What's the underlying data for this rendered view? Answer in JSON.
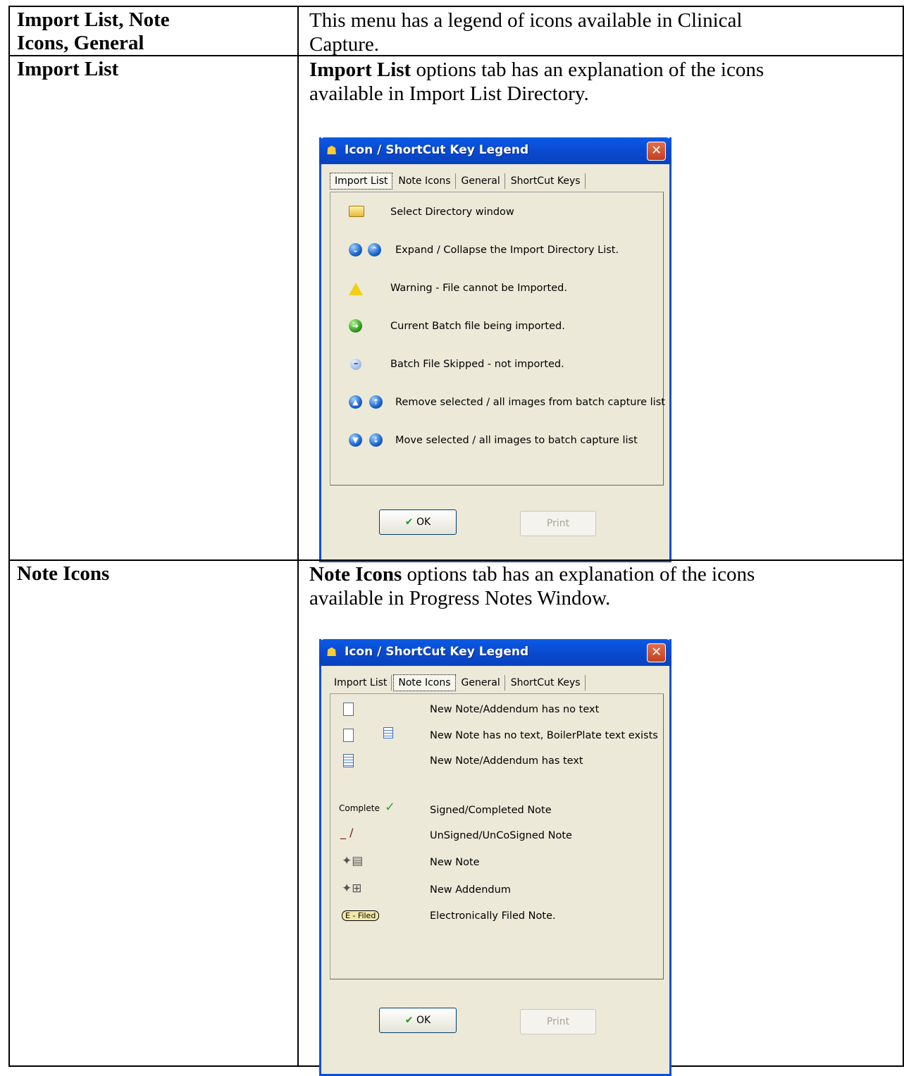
{
  "row1": {
    "heading": "Import List, Note Icons, General",
    "heading_line1": "Import List, Note",
    "heading_line2": "Icons, General",
    "text_line1": "This menu has a legend of icons available in Clinical",
    "text_line2": "Capture."
  },
  "row2": {
    "heading": "Import List",
    "text_bold": "Import List",
    "text_rest_line1": " options tab has an explanation of the icons",
    "text_line2": "available in Import List Directory.",
    "dialog": {
      "title": "Icon / ShortCut Key Legend",
      "tabs": [
        "Import List",
        "Note Icons",
        "General",
        "ShortCut Keys"
      ],
      "active_tab": "Import List",
      "items": [
        {
          "icon": "folder-icon",
          "label": "Select Directory window"
        },
        {
          "icon": "expand-collapse-icons",
          "label": "Expand / Collapse the Import Directory List."
        },
        {
          "icon": "warning-icon",
          "label": "Warning - File cannot be Imported."
        },
        {
          "icon": "green-arrow-icon",
          "label": "Current Batch file being imported."
        },
        {
          "icon": "minus-icon",
          "label": "Batch File Skipped  - not imported."
        },
        {
          "icon": "up-arrows-icon",
          "label": "Remove selected / all images from batch capture list"
        },
        {
          "icon": "down-arrows-icon",
          "label": "Move selected / all images to batch capture list"
        }
      ],
      "ok_label": "OK",
      "print_label": "Print"
    }
  },
  "row3": {
    "heading": "Note Icons",
    "text_bold": "Note Icons",
    "text_rest_line1": " options tab has an explanation of the icons",
    "text_line2": "available in Progress Notes Window.",
    "dialog": {
      "title": "Icon / ShortCut Key Legend",
      "tabs": [
        "Import List",
        "Note Icons",
        "General",
        "ShortCut Keys"
      ],
      "active_tab": "Note Icons",
      "items": [
        {
          "icon": "blank-page-icon",
          "label": "New Note/Addendum has no text"
        },
        {
          "icon": "blank-page-boilerplate-icon",
          "label": "New Note has no text, BoilerPlate text exists"
        },
        {
          "icon": "text-page-icon",
          "label": "New Note/Addendum has text"
        },
        {
          "icon": "complete-check-icon",
          "label": "Signed/Completed Note",
          "prefix": "Complete"
        },
        {
          "icon": "unsigned-pen-icon",
          "label": "UnSigned/UnCoSigned Note"
        },
        {
          "icon": "new-note-icon",
          "label": "New Note"
        },
        {
          "icon": "new-addendum-icon",
          "label": "New Addendum"
        },
        {
          "icon": "e-filed-icon",
          "label": "Electronically Filed Note.",
          "badge": "E - Filed"
        }
      ],
      "ok_label": "OK",
      "print_label": "Print"
    }
  }
}
